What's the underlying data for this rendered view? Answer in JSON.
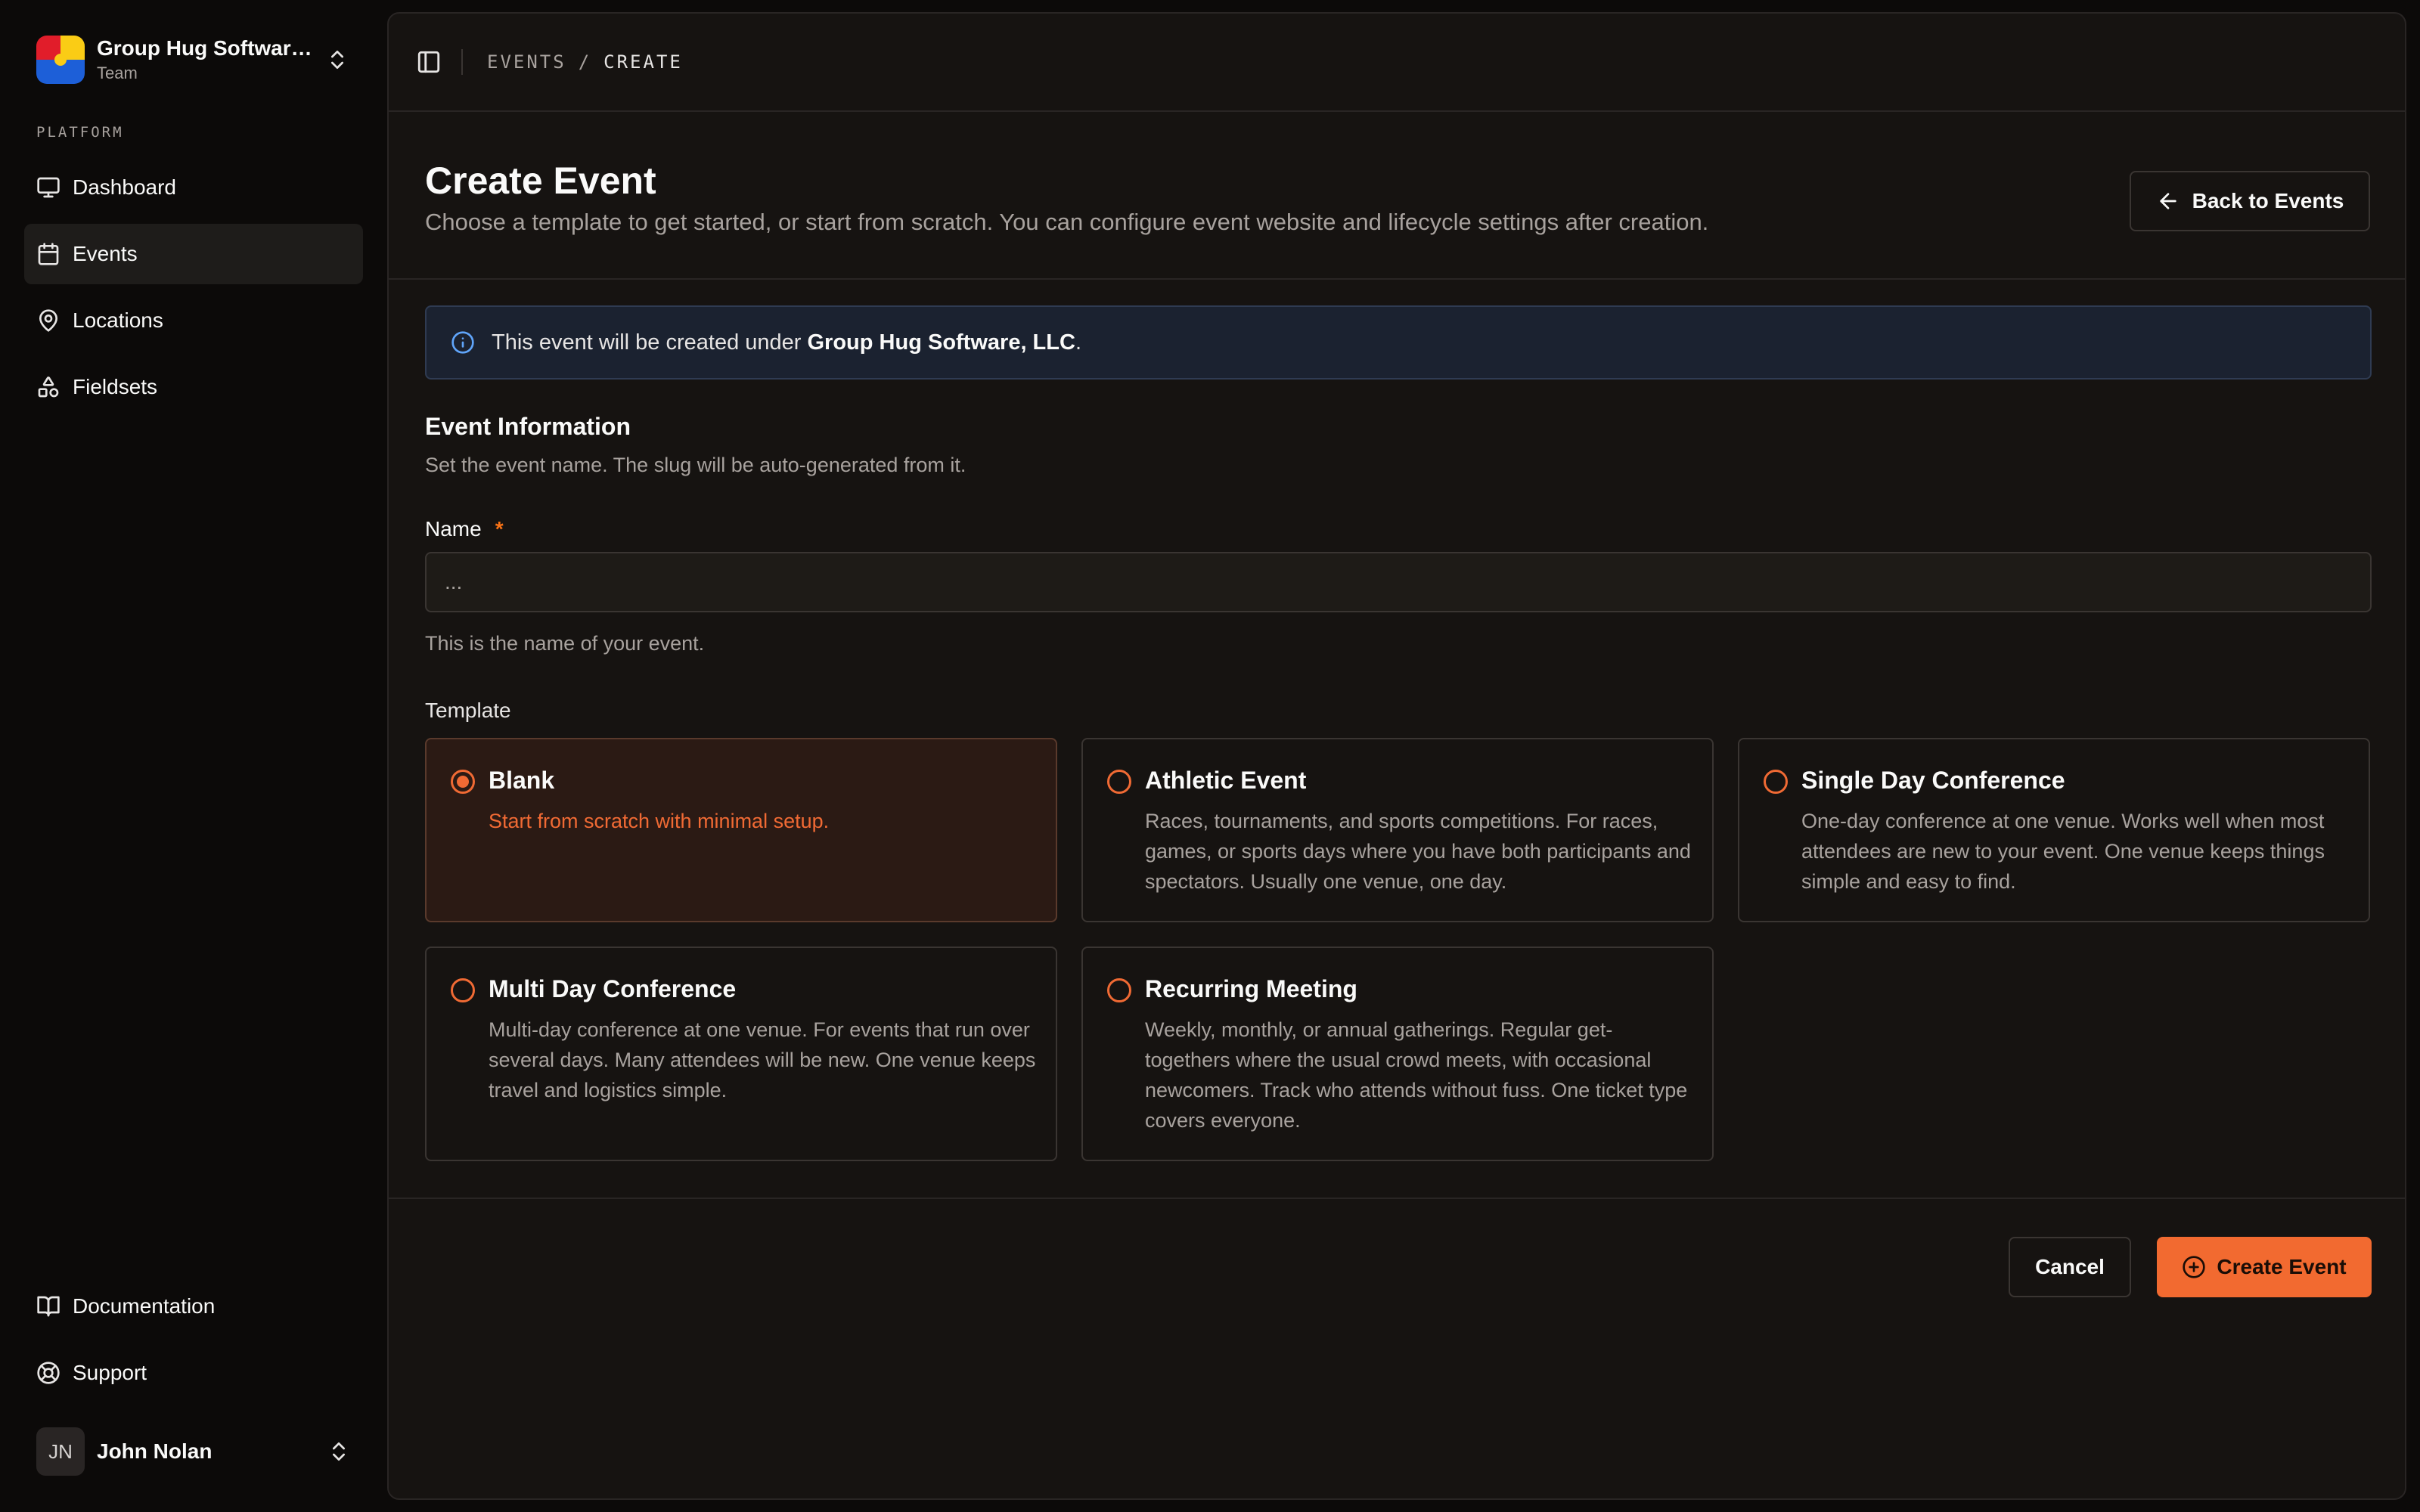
{
  "team": {
    "name": "Group Hug Software...",
    "plan": "Team"
  },
  "sidebar": {
    "group_label": "PLATFORM",
    "items": [
      {
        "label": "Dashboard",
        "icon": "monitor-icon"
      },
      {
        "label": "Events",
        "icon": "calendar-icon",
        "active": true
      },
      {
        "label": "Locations",
        "icon": "map-pin-icon"
      },
      {
        "label": "Fieldsets",
        "icon": "shapes-icon"
      }
    ],
    "footer_items": [
      {
        "label": "Documentation",
        "icon": "book-icon"
      },
      {
        "label": "Support",
        "icon": "life-buoy-icon"
      }
    ],
    "user": {
      "initials": "JN",
      "name": "John Nolan"
    }
  },
  "breadcrumb": {
    "parent": "EVENTS",
    "separator": "/",
    "current": "CREATE"
  },
  "header": {
    "title": "Create Event",
    "description": "Choose a template to get started, or start from scratch. You can configure event website and lifecycle settings after creation.",
    "back_label": "Back to Events"
  },
  "notice": {
    "prefix": "This event will be created under ",
    "org": "Group Hug Software, LLC",
    "suffix": "."
  },
  "event_info": {
    "title": "Event Information",
    "description": "Set the event name. The slug will be auto-generated from it.",
    "name_label": "Name",
    "required_mark": "*",
    "name_placeholder": "...",
    "name_value": "",
    "name_help": "This is the name of your event."
  },
  "template": {
    "label": "Template",
    "options": [
      {
        "title": "Blank",
        "description": "Start from scratch with minimal setup.",
        "selected": true
      },
      {
        "title": "Athletic Event",
        "description": "Races, tournaments, and sports competitions. For races, games, or sports days where you have both participants and spectators. Usually one venue, one day."
      },
      {
        "title": "Single Day Conference",
        "description": "One-day conference at one venue. Works well when most attendees are new to your event. One venue keeps things simple and easy to find."
      },
      {
        "title": "Multi Day Conference",
        "description": "Multi-day conference at one venue. For events that run over several days. Many attendees will be new. One venue keeps travel and logistics simple."
      },
      {
        "title": "Recurring Meeting",
        "description": "Weekly, monthly, or annual gatherings. Regular get-togethers where the usual crowd meets, with occasional newcomers. Track who attends without fuss. One ticket type covers everyone."
      }
    ]
  },
  "actions": {
    "cancel_label": "Cancel",
    "create_label": "Create Event"
  },
  "colors": {
    "accent": "#f26a30",
    "background": "#0c0a09",
    "panel": "#161311"
  }
}
